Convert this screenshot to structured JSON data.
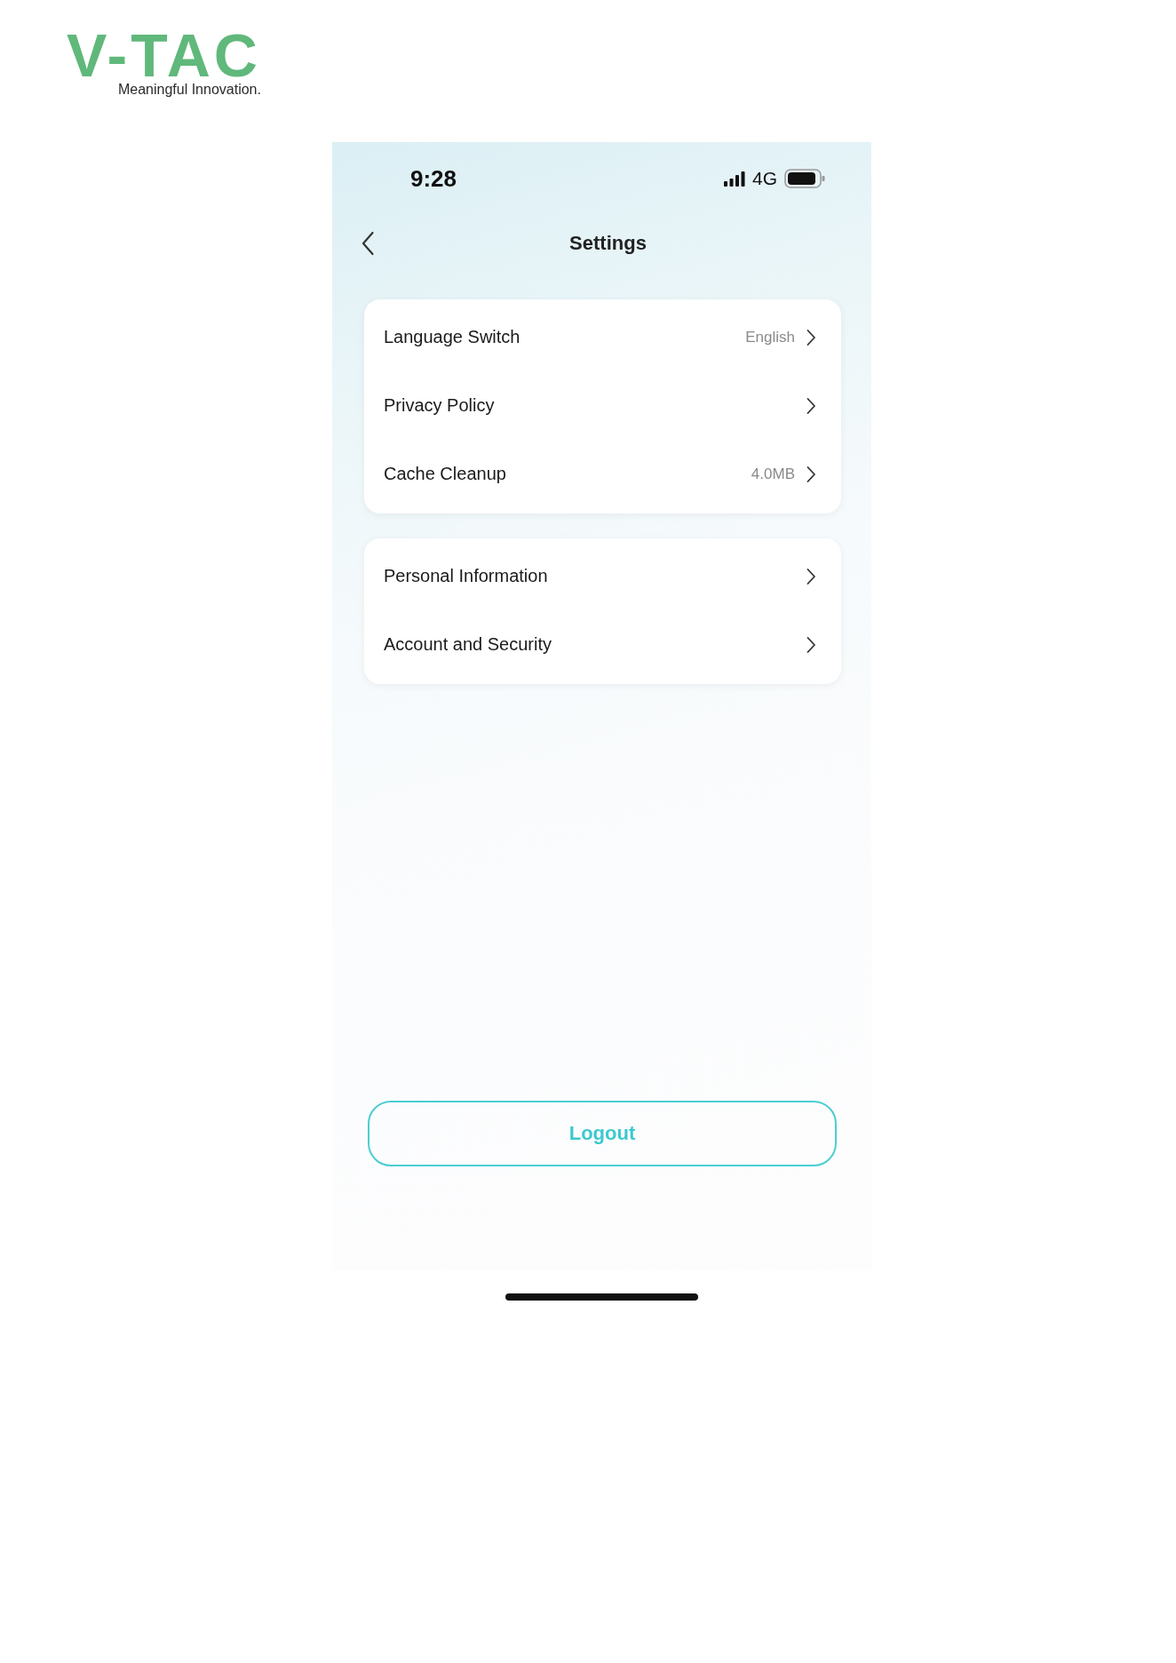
{
  "logo": {
    "wordmark": "V-TAC",
    "tagline": "Meaningful Innovation."
  },
  "status_bar": {
    "time": "9:28",
    "network": "4G"
  },
  "header": {
    "title": "Settings"
  },
  "groups": [
    {
      "items": [
        {
          "label": "Language Switch",
          "value": "English"
        },
        {
          "label": "Privacy Policy"
        },
        {
          "label": "Cache Cleanup",
          "value": "4.0MB"
        }
      ]
    },
    {
      "items": [
        {
          "label": "Personal Information"
        },
        {
          "label": "Account and Security"
        }
      ]
    }
  ],
  "logout_button": {
    "label": "Logout"
  }
}
